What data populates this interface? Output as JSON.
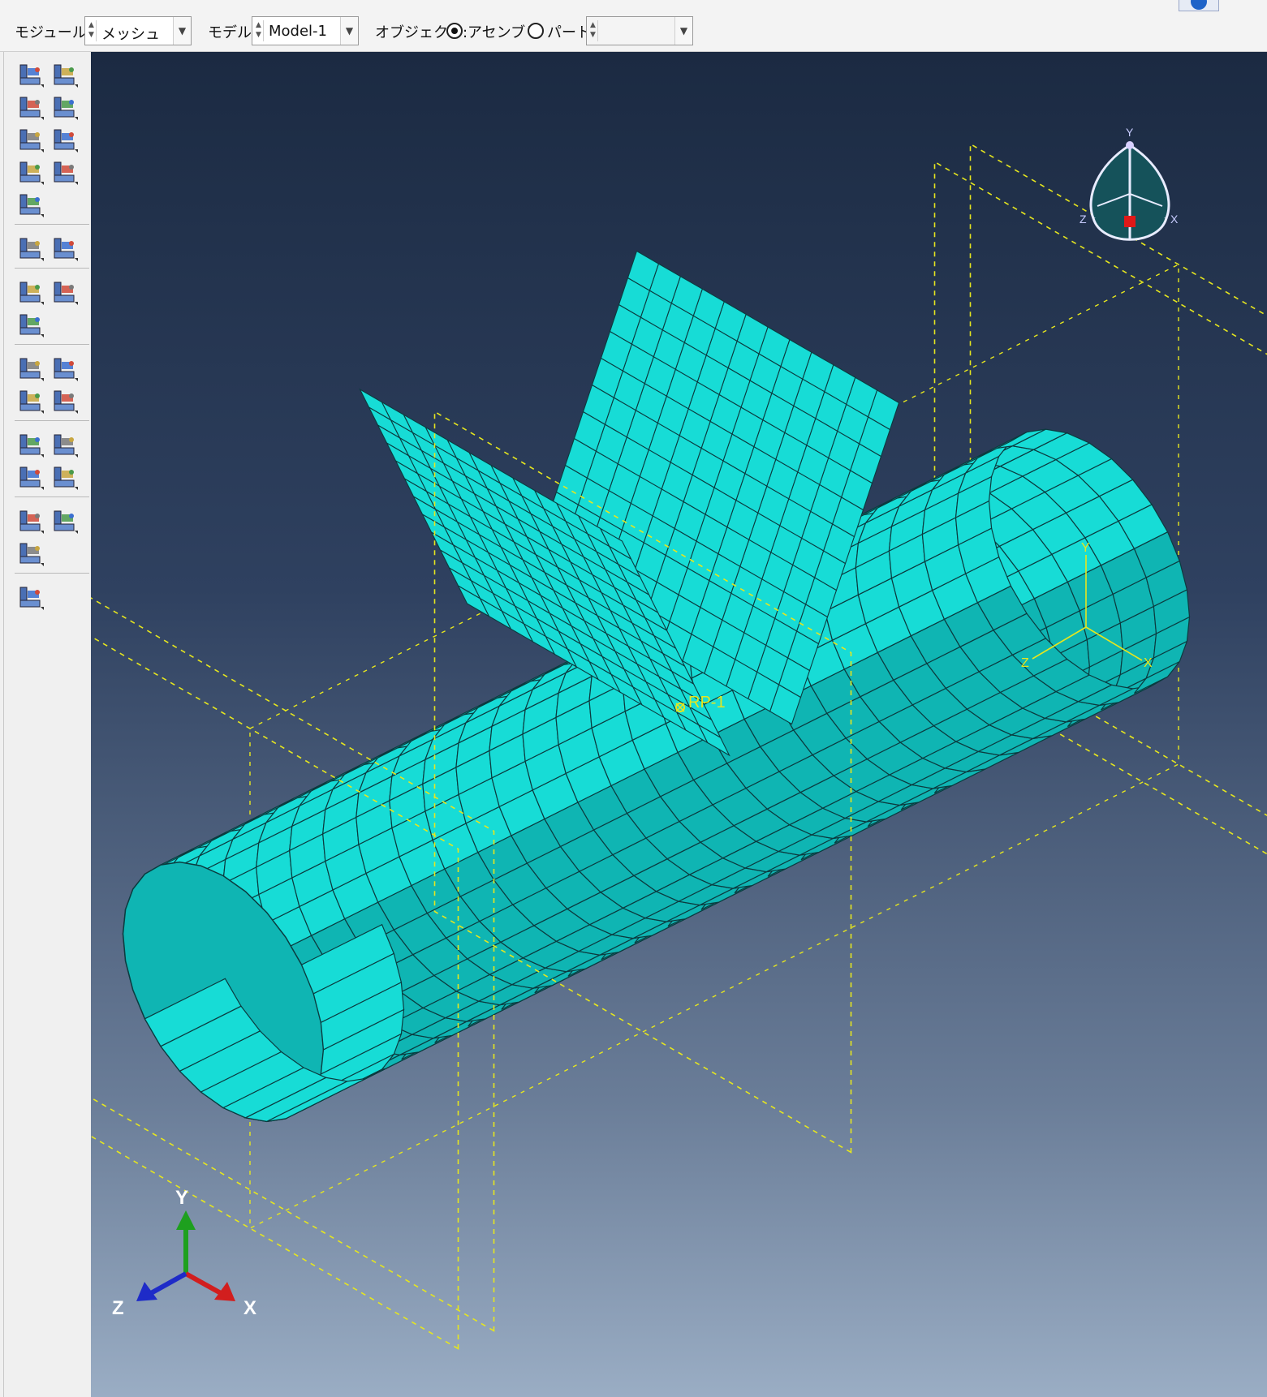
{
  "context_bar": {
    "module_label": "モジュール:",
    "module_value": "メッシュ",
    "model_label": "モデル:",
    "model_value": "Model-1",
    "object_label": "オブジェクト:",
    "assembly_option": "アセンブリ",
    "part_option": "パート:",
    "part_value": "",
    "selected_object": "assembly"
  },
  "palette": {
    "tools": [
      "seed-part-instance-icon",
      "seed-edges-icon",
      "seed-part-icon",
      "seed-edge-bias-icon",
      "assign-mesh-controls-icon",
      "partition-cell-icon",
      "assign-element-type-icon",
      "verify-mesh-icon",
      "mesh-part-instance-icon",
      "mesh-query-icon",
      "mesh-options-icon",
      "edit-mesh-icon",
      "mesh-region-icon",
      "create-mesh-part-icon",
      "partition-edge-icon",
      "partition-face-icon",
      "virtual-topology-icon",
      "delete-partition-icon",
      "datum-point-icon",
      "datum-axis-icon",
      "datum-plane-icon",
      "datum-csys-icon",
      "mesh-edit-node-icon",
      "mesh-edit-element-icon",
      "mesh-boundary-icon",
      "tools-icon"
    ]
  },
  "viewport": {
    "reference_point_label": "RP-1",
    "triad": {
      "x": "X",
      "y": "Y",
      "z": "Z"
    },
    "view_cube": {
      "x": "X",
      "y": "Y",
      "z": "Z"
    },
    "local_csys": {
      "x": "X",
      "y": "Y",
      "z": "Z"
    },
    "colors": {
      "mesh_fill": "#17dcd6",
      "mesh_fill_shade": "#0fb5b3",
      "mesh_edges": "#0b3b3f",
      "datum": "#e6e61e",
      "triad_x": "#d21e1e",
      "triad_y": "#1ea01e",
      "triad_z": "#1e2bc8"
    }
  }
}
